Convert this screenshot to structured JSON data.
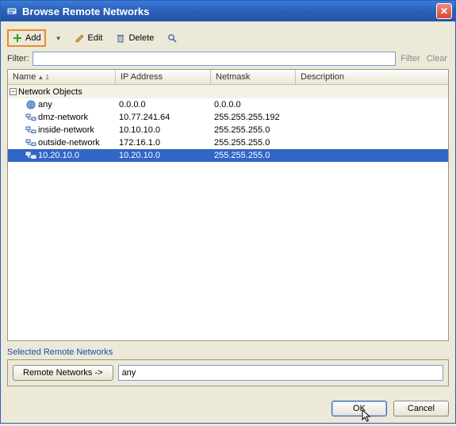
{
  "window": {
    "title": "Browse Remote Networks"
  },
  "toolbar": {
    "add_label": "Add",
    "edit_label": "Edit",
    "delete_label": "Delete"
  },
  "filter": {
    "label": "Filter:",
    "value": "",
    "filter_btn": "Filter",
    "clear_btn": "Clear"
  },
  "columns": {
    "name": "Name",
    "sort_indicator": "▲ 1",
    "ip": "IP Address",
    "netmask": "Netmask",
    "description": "Description"
  },
  "group": {
    "label": "Network Objects",
    "expanded": true
  },
  "rows": [
    {
      "name": "any",
      "ip": "0.0.0.0",
      "mask": "0.0.0.0",
      "desc": "",
      "icon": "globe",
      "selected": false
    },
    {
      "name": "dmz-network",
      "ip": "10.77.241.64",
      "mask": "255.255.255.192",
      "desc": "",
      "icon": "network",
      "selected": false
    },
    {
      "name": "inside-network",
      "ip": "10.10.10.0",
      "mask": "255.255.255.0",
      "desc": "",
      "icon": "network",
      "selected": false
    },
    {
      "name": "outside-network",
      "ip": "172.16.1.0",
      "mask": "255.255.255.0",
      "desc": "",
      "icon": "network",
      "selected": false
    },
    {
      "name": "10.20.10.0",
      "ip": "10.20.10.0",
      "mask": "255.255.255.0",
      "desc": "",
      "icon": "network",
      "selected": true
    }
  ],
  "selected_section": {
    "title": "Selected Remote Networks",
    "button": "Remote Networks ->",
    "value": "any"
  },
  "footer": {
    "ok": "OK",
    "cancel": "Cancel"
  }
}
